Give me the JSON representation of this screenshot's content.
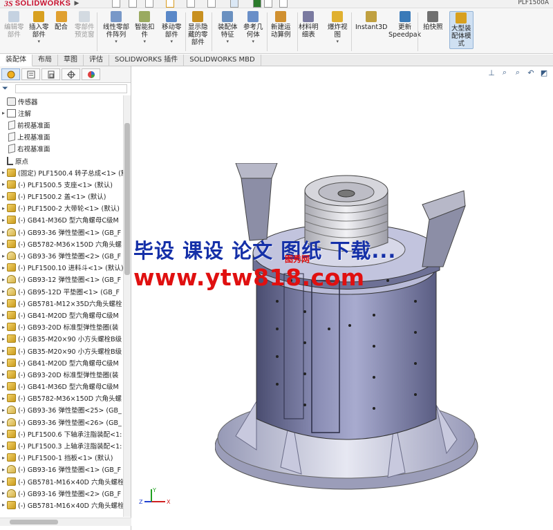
{
  "app": {
    "logo_ds": "3S",
    "logo_name": "SOLIDWORKS",
    "doc_title": "PLF1500A"
  },
  "ribbon": {
    "tools": [
      {
        "label": "编辑零\n部件",
        "icon": "edit-component-icon",
        "enabled": false
      },
      {
        "label": "插入零\n部件",
        "icon": "insert-component-icon",
        "enabled": true
      },
      {
        "label": "配合",
        "icon": "mate-icon",
        "enabled": true
      },
      {
        "label": "零部件\n预览窗",
        "icon": "component-preview-icon",
        "enabled": false
      },
      {
        "label": "线性零部\n件阵列",
        "icon": "linear-pattern-icon",
        "enabled": true
      },
      {
        "label": "智能扣\n件",
        "icon": "smart-fastener-icon",
        "enabled": true
      },
      {
        "label": "移动零\n部件",
        "icon": "move-component-icon",
        "enabled": true
      },
      {
        "label": "显示隐\n藏的零\n部件",
        "icon": "show-hidden-icon",
        "enabled": true
      },
      {
        "label": "装配体\n特征",
        "icon": "assembly-feature-icon",
        "enabled": true
      },
      {
        "label": "参考几\n何体",
        "icon": "reference-geometry-icon",
        "enabled": true
      },
      {
        "label": "新建运\n动算例",
        "icon": "new-motion-study-icon",
        "enabled": true
      },
      {
        "label": "材料明\n细表",
        "icon": "bom-icon",
        "enabled": true
      },
      {
        "label": "爆炸视\n图",
        "icon": "exploded-view-icon",
        "enabled": true
      },
      {
        "label": "Instant3D",
        "icon": "instant3d-icon",
        "enabled": true
      },
      {
        "label": "更新\nSpeedpak",
        "icon": "speedpak-icon",
        "enabled": true
      },
      {
        "label": "拍快照",
        "icon": "snapshot-icon",
        "enabled": true
      },
      {
        "label": "大型装\n配体模\n式",
        "icon": "large-assembly-icon",
        "enabled": true
      }
    ]
  },
  "tabs": [
    "装配体",
    "布局",
    "草图",
    "评估",
    "SOLIDWORKS 插件",
    "SOLIDWORKS MBD"
  ],
  "tree": [
    {
      "label": "传感器",
      "icon": "sensor-icon",
      "exp": ""
    },
    {
      "label": "注解",
      "icon": "annotation-icon",
      "exp": "▸"
    },
    {
      "label": "前视基准面",
      "icon": "plane-icon",
      "exp": ""
    },
    {
      "label": "上视基准面",
      "icon": "plane-icon",
      "exp": ""
    },
    {
      "label": "右视基准面",
      "icon": "plane-icon",
      "exp": ""
    },
    {
      "label": "原点",
      "icon": "origin-icon",
      "exp": ""
    },
    {
      "label": "(固定) PLF1500.4 转子总成<1> (默",
      "icon": "part-icon",
      "exp": "▸"
    },
    {
      "label": "(-) PLF1500.5 支座<1> (默认)",
      "icon": "part-icon",
      "exp": "▸"
    },
    {
      "label": "(-) PLF1500.2 盖<1> (默认)",
      "icon": "part-icon",
      "exp": "▸"
    },
    {
      "label": "(-) PLF1500-2 大带轮<1> (默认)",
      "icon": "part-icon",
      "exp": "▸"
    },
    {
      "label": "(-) GB41-M36D 型六角螺母C级M",
      "icon": "part-icon",
      "exp": "▸"
    },
    {
      "label": "(-) GB93-36 弹性垫圈<1> (GB_F",
      "icon": "std-icon",
      "exp": "▸"
    },
    {
      "label": "(-) GB5782-M36×150D 六角头螺",
      "icon": "part-icon",
      "exp": "▸"
    },
    {
      "label": "(-) GB93-36 弹性垫圈<2> (GB_F",
      "icon": "std-icon",
      "exp": "▸"
    },
    {
      "label": "(-) PLF1500.10 进料斗<1> (默认)",
      "icon": "part-icon",
      "exp": "▸"
    },
    {
      "label": "(-) GB93-12 弹性垫圈<1> (GB_F",
      "icon": "std-icon",
      "exp": "▸"
    },
    {
      "label": "(-) GB95-12D 平垫圈<1> (GB_F",
      "icon": "std-icon",
      "exp": "▸"
    },
    {
      "label": "(-) GB5781-M12×35D六角头螺栓",
      "icon": "part-icon",
      "exp": "▸"
    },
    {
      "label": "(-) GB41-M20D 型六角螺母C级M",
      "icon": "part-icon",
      "exp": "▸"
    },
    {
      "label": "(-) GB93-20D 标准型弹性垫圈(装",
      "icon": "part-icon",
      "exp": "▸"
    },
    {
      "label": "(-) GB35-M20×90 小方头螺栓B级",
      "icon": "part-icon",
      "exp": "▸"
    },
    {
      "label": "(-) GB35-M20×90 小方头螺栓B级",
      "icon": "part-icon",
      "exp": "▸"
    },
    {
      "label": "(-) GB41-M20D 型六角螺母C级M",
      "icon": "part-icon",
      "exp": "▸"
    },
    {
      "label": "(-) GB93-20D 标准型弹性垫圈(装",
      "icon": "part-icon",
      "exp": "▸"
    },
    {
      "label": "(-) GB41-M36D 型六角螺母C级M",
      "icon": "part-icon",
      "exp": "▸"
    },
    {
      "label": "(-) GB5782-M36×150D 六角头螺",
      "icon": "part-icon",
      "exp": "▸"
    },
    {
      "label": "(-) GB93-36 弹性垫圈<25> (GB_",
      "icon": "std-icon",
      "exp": "▸"
    },
    {
      "label": "(-) GB93-36 弹性垫圈<26> (GB_",
      "icon": "std-icon",
      "exp": "▸"
    },
    {
      "label": "(-) PLF1500.6 下轴承注脂装配<1:",
      "icon": "part-icon",
      "exp": "▸"
    },
    {
      "label": "(-) PLF1500.3 上轴承注脂装配<1:",
      "icon": "part-icon",
      "exp": "▸"
    },
    {
      "label": "(-) PLF1500-1 挡板<1> (默认)",
      "icon": "part-icon",
      "exp": "▸"
    },
    {
      "label": "(-) GB93-16 弹性垫圈<1> (GB_F",
      "icon": "std-icon",
      "exp": "▸"
    },
    {
      "label": "(-) GB5781-M16×40D 六角头螺栓",
      "icon": "part-icon",
      "exp": "▸"
    },
    {
      "label": "(-) GB93-16 弹性垫圈<2> (GB_F",
      "icon": "std-icon",
      "exp": "▸"
    },
    {
      "label": "(-) GB5781-M16×40D 六角头螺栓",
      "icon": "part-icon",
      "exp": "▸"
    }
  ],
  "watermark": {
    "line1": "毕设 课设 论文 图纸 下载...",
    "line2": "www.ytw818.com",
    "small": "图秀网"
  },
  "triad": {
    "z": "Z",
    "x": "X",
    "y": "Y"
  }
}
